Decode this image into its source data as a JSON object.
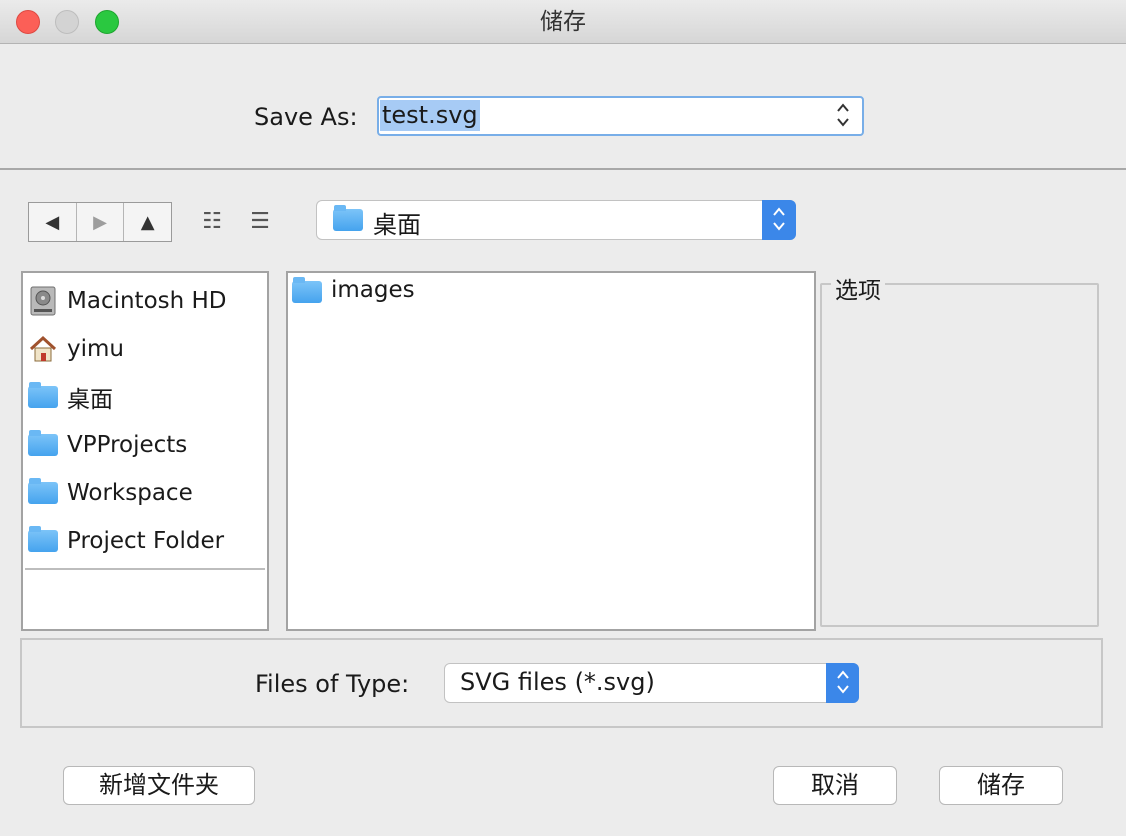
{
  "window": {
    "title": "储存"
  },
  "save_as": {
    "label": "Save As:",
    "value": "test.svg"
  },
  "toolbar": {
    "back_icon": "◀",
    "forward_icon": "▶",
    "up_icon": "▲",
    "list_view_icon": "☷",
    "details_view_icon": "☰"
  },
  "directory": {
    "current": "桌面"
  },
  "sidebar": {
    "items": [
      {
        "label": "Macintosh HD",
        "icon": "hard-drive-icon"
      },
      {
        "label": "yimu",
        "icon": "home-icon"
      },
      {
        "label": "桌面",
        "icon": "desktop-folder-icon"
      },
      {
        "label": "VPProjects",
        "icon": "folder-icon"
      },
      {
        "label": "Workspace",
        "icon": "folder-icon"
      },
      {
        "label": "Project Folder",
        "icon": "folder-icon"
      }
    ]
  },
  "files": [
    {
      "name": "images",
      "icon": "folder-icon"
    }
  ],
  "options": {
    "label": "选项"
  },
  "file_type": {
    "label": "Files of Type:",
    "value": "SVG files (*.svg)"
  },
  "buttons": {
    "new_folder": "新增文件夹",
    "cancel": "取消",
    "save": "储存"
  },
  "colors": {
    "accent": "#3b87e9",
    "selection": "#a7cbf5",
    "folder": "#5ab0f2"
  }
}
